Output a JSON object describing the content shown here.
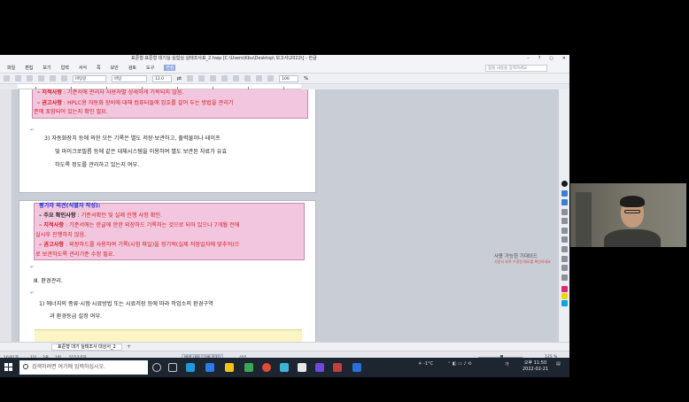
{
  "window": {
    "title": "표준형·표준형 대기실·실험실 실태조사표_2.hwp [C:\\Users\\Kbu\\Desktop\\ 보고서\\2022\\] - 한글",
    "controls": [
      "–",
      "?",
      "○",
      "✕"
    ]
  },
  "menu": {
    "items": [
      "파일",
      "편집",
      "보기",
      "입력",
      "서식",
      "쪽",
      "보안",
      "검토",
      "도구"
    ],
    "active": "한컴",
    "search_placeholder": "찾을 내용을 입력하세요"
  },
  "toolbar": {
    "style": "바탕글",
    "font": "바탕",
    "size": "12.0",
    "unit": "pt",
    "zoom": "100",
    "zoom_unit": "%"
  },
  "document": {
    "page1": {
      "lines": [
        {
          "label": "– 지적사항",
          "text": " : 기준서에 관리자 사용자별 상세하게 기록되지 않음."
        },
        {
          "label": "– 권고사항",
          "text": " : HPLC용 자동화 장비에 대해 컴퓨터들에 암호를 걸어 두는 방법을 관리기"
        },
        {
          "label": "",
          "text": "준에 포함되어 있는지 확인 필요."
        }
      ],
      "item3": [
        "3) 자동화장치 등에 의한 모든 기록은 별도 저장·보관하고, 출력물이나 테이프",
        "및 마이크로필름 등에 같은 대체시스템을 이용하여 별도 보관된 자료가 유효",
        "하도록 정도를 관리하고 있는지 여부."
      ]
    },
    "page2": {
      "header": "평가자 의견(식별자 작성):",
      "lines": [
        {
          "label": "– 주요 확인사항",
          "text": " : 기준서확인 및 실제 진행 사항 확인."
        },
        {
          "label": "– 지적사항",
          "text": " : 기준서에는 한글에 한한 외장하드 기록하는 것으로 되어 있으나 7개월 전에"
        },
        {
          "label": "",
          "text": "실시후 진행하지 않음."
        },
        {
          "label": "– 권고사항",
          "text": " : 외장하드를 사용하여 기록(시험 파일)을 정기적(실제 저장일자에 맞추어)으"
        },
        {
          "label": "",
          "text": "로 보관하도록 관리기준 수정 필요."
        }
      ],
      "section": "Ⅲ. 환경관리.",
      "item1": [
        "1) 에너지의 종류·시험·시료방법 또는 시료저장 등에 따라 작업소의 환경구역",
        "과 환경등급 설정 여부."
      ]
    }
  },
  "memo": {
    "title": "사용 가능한 기대이드",
    "sub": "기준서 자주 수정된 메모를 확인하세요"
  },
  "tabs": {
    "doc_tab": "표준형 대기 실태조사 대상서_2",
    "add": "+"
  },
  "status": {
    "page": "16/81쪽",
    "section": "1단",
    "line": "2줄",
    "col": "1칸",
    "chars": "5552글자",
    "mode": "변경 내용 [기록 중지]",
    "insert": "삽입",
    "zoom": "125 %"
  },
  "taskbar": {
    "search_placeholder": "검색하려면 여기에 입력하십시오.",
    "weather": "-1°C",
    "time": "오후 11:50",
    "date": "2022-02-21",
    "lang": "가"
  },
  "colors": {
    "pink_box": "#f3c6df",
    "red_text": "#d41a1a",
    "blue_text": "#1a2ad4",
    "memo_highlight": "#fbf4c4"
  }
}
